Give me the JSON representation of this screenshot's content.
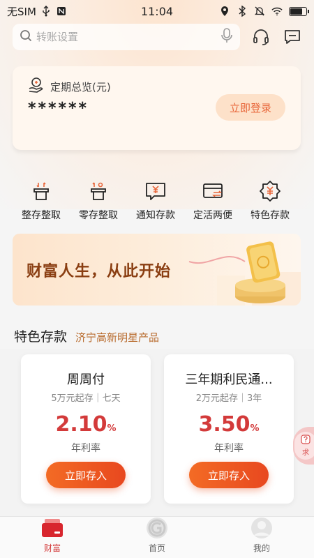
{
  "status_bar": {
    "carrier": "无SIM",
    "time": "11:04",
    "battery_level": 0.85
  },
  "search": {
    "placeholder": "转账设置"
  },
  "header_icons": [
    "customer-service-icon",
    "message-icon"
  ],
  "overview": {
    "title": "定期总览(元)",
    "amount_masked": "******",
    "login_label": "立即登录"
  },
  "quick_nav": [
    {
      "label": "整存整取",
      "icon": "lump-sum-deposit-icon"
    },
    {
      "label": "零存整取",
      "icon": "installment-deposit-icon"
    },
    {
      "label": "通知存款",
      "icon": "notice-deposit-icon"
    },
    {
      "label": "定活两便",
      "icon": "flexible-deposit-icon"
    },
    {
      "label": "特色存款",
      "icon": "special-deposit-icon"
    }
  ],
  "banner": {
    "text": "财富人生，从此开始"
  },
  "featured": {
    "title": "特色存款",
    "subtitle": "济宁高新明星产品",
    "products": [
      {
        "name": "周周付",
        "meta": "5万元起存｜七天",
        "rate": "2.10",
        "rate_unit": "%",
        "rate_label": "年利率",
        "button": "立即存入"
      },
      {
        "name": "三年期利民通...",
        "meta": "2万元起存｜3年",
        "rate": "3.50",
        "rate_unit": "%",
        "rate_label": "年利率",
        "button": "立即存入"
      }
    ]
  },
  "float_widget": {
    "text": "求"
  },
  "tabs": [
    {
      "label": "财富",
      "active": true
    },
    {
      "label": "首页",
      "active": false
    },
    {
      "label": "我的",
      "active": false
    }
  ],
  "colors": {
    "accent": "#e8481f",
    "rate_red": "#d33a3a",
    "banner_text": "#8a3e12",
    "section_sub": "#b86a2c"
  }
}
